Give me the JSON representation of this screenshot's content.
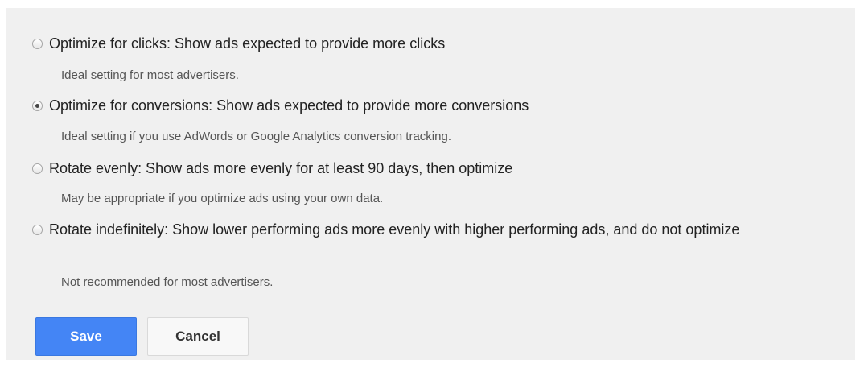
{
  "options": [
    {
      "label": "Optimize for clicks: Show ads expected to provide more clicks",
      "description": "Ideal setting for most advertisers.",
      "selected": false
    },
    {
      "label": "Optimize for conversions: Show ads expected to provide more conversions",
      "description": "Ideal setting if you use AdWords or Google Analytics conversion tracking.",
      "selected": true
    },
    {
      "label": "Rotate evenly: Show ads more evenly for at least 90 days, then optimize",
      "description": "May be appropriate if you optimize ads using your own data.",
      "selected": false
    },
    {
      "label": "Rotate indefinitely: Show lower performing ads more evenly with higher performing ads, and do not optimize",
      "description": "Not recommended for most advertisers.",
      "selected": false
    }
  ],
  "buttons": {
    "save_label": "Save",
    "cancel_label": "Cancel"
  },
  "colors": {
    "panel_background": "#f0f0f0",
    "save_button": "#4485f5",
    "cancel_button": "#f8f8f8"
  }
}
